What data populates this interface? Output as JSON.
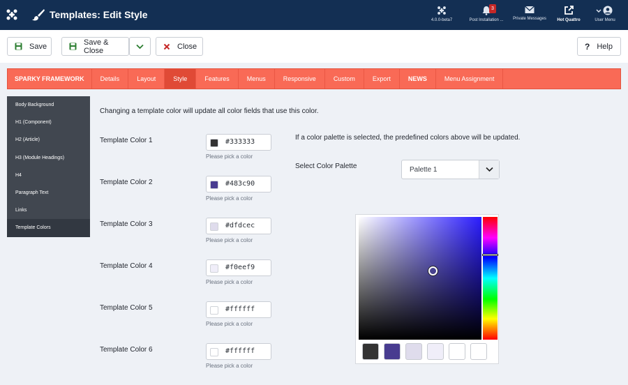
{
  "header": {
    "title": "Templates: Edit Style",
    "items": [
      {
        "label": "4.0.0-beta7",
        "icon": "joomla-icon"
      },
      {
        "label": "Post Installation ...",
        "icon": "bell-icon",
        "badge": "3"
      },
      {
        "label": "Private Messages",
        "icon": "envelope-icon"
      },
      {
        "label": "Hot Quattro",
        "icon": "external-link-icon"
      },
      {
        "label": "User Menu",
        "icon": "user-icon"
      }
    ]
  },
  "toolbar": {
    "save": "Save",
    "save_close": "Save & Close",
    "close": "Close",
    "help": "Help"
  },
  "tabs": [
    "SPARKY FRAMEWORK",
    "Details",
    "Layout",
    "Style",
    "Features",
    "Menus",
    "Responsive",
    "Custom",
    "Export",
    "NEWS",
    "Menu Assignment"
  ],
  "active_tab": "Style",
  "sidebar": {
    "items": [
      "Body Background",
      "H1 (Component)",
      "H2 (Article)",
      "H3 (Module Headings)",
      "H4",
      "Paragraph Text",
      "Links",
      "Template Colors"
    ],
    "active": "Template Colors"
  },
  "content": {
    "intro": "Changing a template color will update all color fields that use this color.",
    "colors": [
      {
        "label": "Template Color 1",
        "value": "#333333",
        "hint": "Please pick a color"
      },
      {
        "label": "Template Color 2",
        "value": "#483c90",
        "hint": "Please pick a color"
      },
      {
        "label": "Template Color 3",
        "value": "#dfdcec",
        "hint": "Please pick a color"
      },
      {
        "label": "Template Color 4",
        "value": "#f0eef9",
        "hint": "Please pick a color"
      },
      {
        "label": "Template Color 5",
        "value": "#ffffff",
        "hint": "Please pick a color"
      },
      {
        "label": "Template Color 6",
        "value": "#ffffff",
        "hint": "Please pick a color"
      }
    ],
    "palette_note": "If a color palette is selected, the predefined colors above will be updated.",
    "palette_label": "Select Color Palette",
    "palette_value": "Palette 1",
    "picker_swatches": [
      "#333333",
      "#483c90",
      "#dfdcec",
      "#f0eef9",
      "#ffffff",
      "#ffffff"
    ]
  },
  "colors": {
    "header_bg": "#132f53",
    "tab_bar": "#f96a56",
    "tab_active": "#e04a36",
    "sidebar_bg": "#414750",
    "save_icon": "#2a7d2f",
    "close_icon": "#c52827"
  }
}
